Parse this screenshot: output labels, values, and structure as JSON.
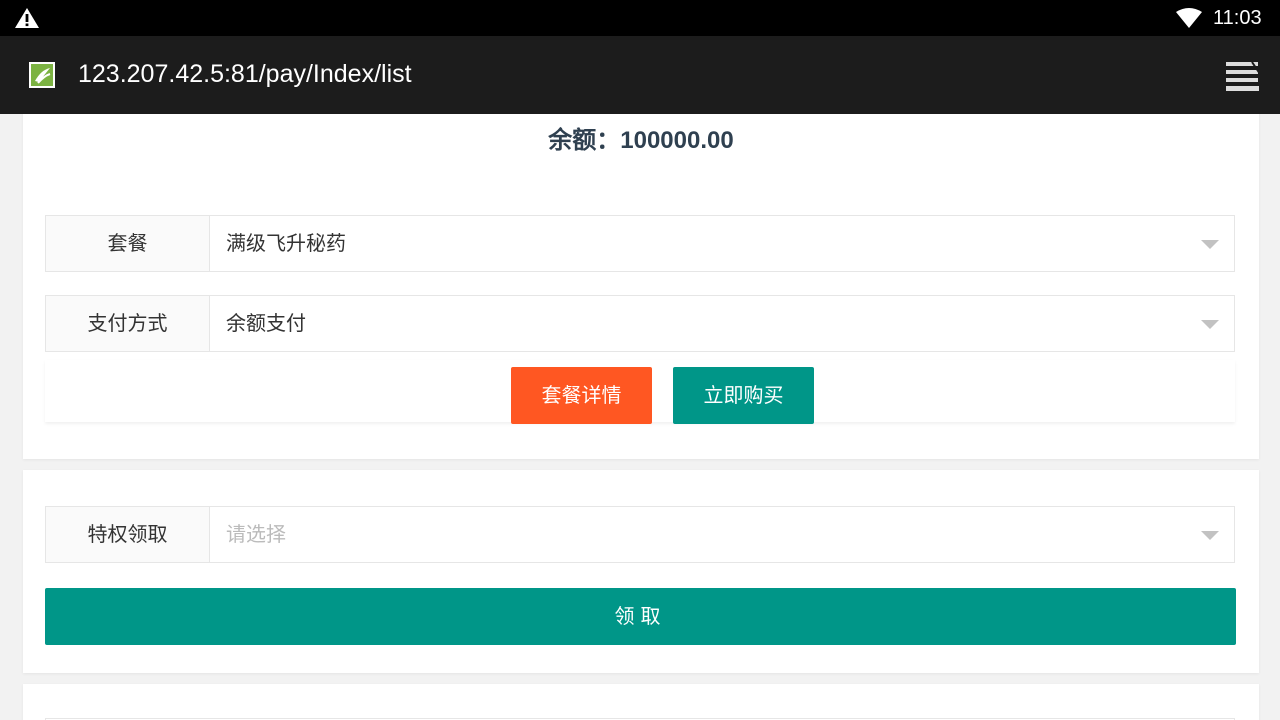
{
  "status_bar": {
    "time": "11:03",
    "icons": [
      "warning-icon",
      "wifi-icon"
    ]
  },
  "browser": {
    "url": "123.207.42.5:81/pay/Index/list",
    "icons": [
      "site-favicon",
      "tabs-icon"
    ]
  },
  "balance": {
    "label": "余额：",
    "amount": "100000.00"
  },
  "purchase_form": {
    "package": {
      "label": "套餐",
      "value": "满级飞升秘药"
    },
    "payment": {
      "label": "支付方式",
      "value": "余额支付"
    },
    "details_button": "套餐详情",
    "buy_button": "立即购买"
  },
  "claim_form": {
    "privilege": {
      "label": "特权领取",
      "placeholder": "请选择"
    },
    "claim_button": "领取"
  },
  "colors": {
    "accent_teal": "#009688",
    "accent_orange": "#ff5722",
    "text_dark": "#2f4050"
  }
}
